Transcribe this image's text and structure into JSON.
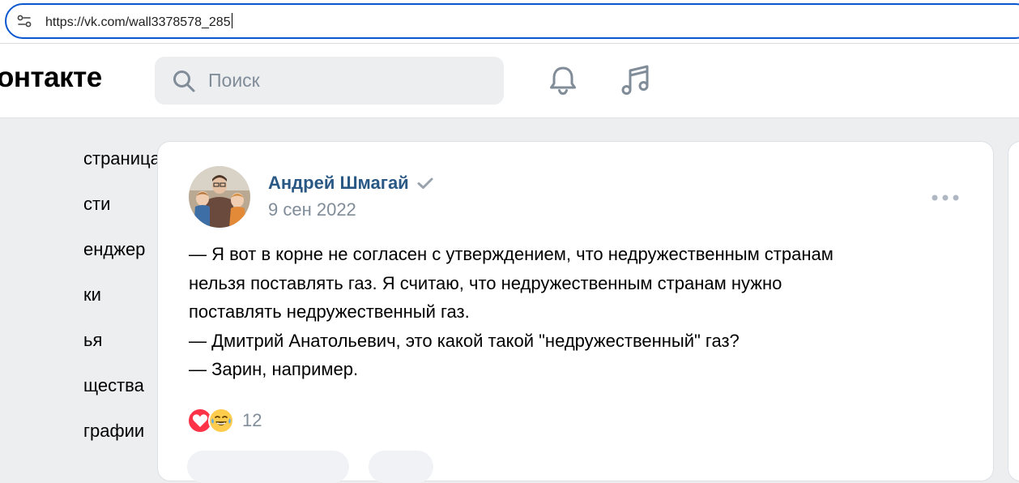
{
  "browser": {
    "url": "https://vk.com/wall3378578_285"
  },
  "header": {
    "logo_text": "онтакте",
    "search_placeholder": "Поиск",
    "icons": [
      "bell-icon",
      "music-icon"
    ]
  },
  "sidebar": {
    "items": [
      {
        "label": "страница"
      },
      {
        "label": "сти"
      },
      {
        "label": "енджер"
      },
      {
        "label": "ки"
      },
      {
        "label": "ья"
      },
      {
        "label": "щества"
      },
      {
        "label": "графии"
      }
    ]
  },
  "post": {
    "author": "Андрей Шмагай",
    "date": "9 сен 2022",
    "lines": [
      "— Я вот в корне не согласен с утверждением, что недружественным странам",
      "нельзя поставлять газ. Я считаю, что недружественным странам нужно",
      "поставлять недружественный газ.",
      "— Дмитрий Анатольевич, это какой такой \"недружественный\" газ?",
      "— Зарин, например."
    ],
    "reactions_count": "12",
    "reaction_icons": [
      "heart-icon",
      "laughing-emoji-icon"
    ]
  },
  "colors": {
    "accent": "#0b57d0",
    "link": "#2a5885",
    "muted": "#818c99",
    "bg": "#edeef0",
    "like": "#ff3347"
  }
}
